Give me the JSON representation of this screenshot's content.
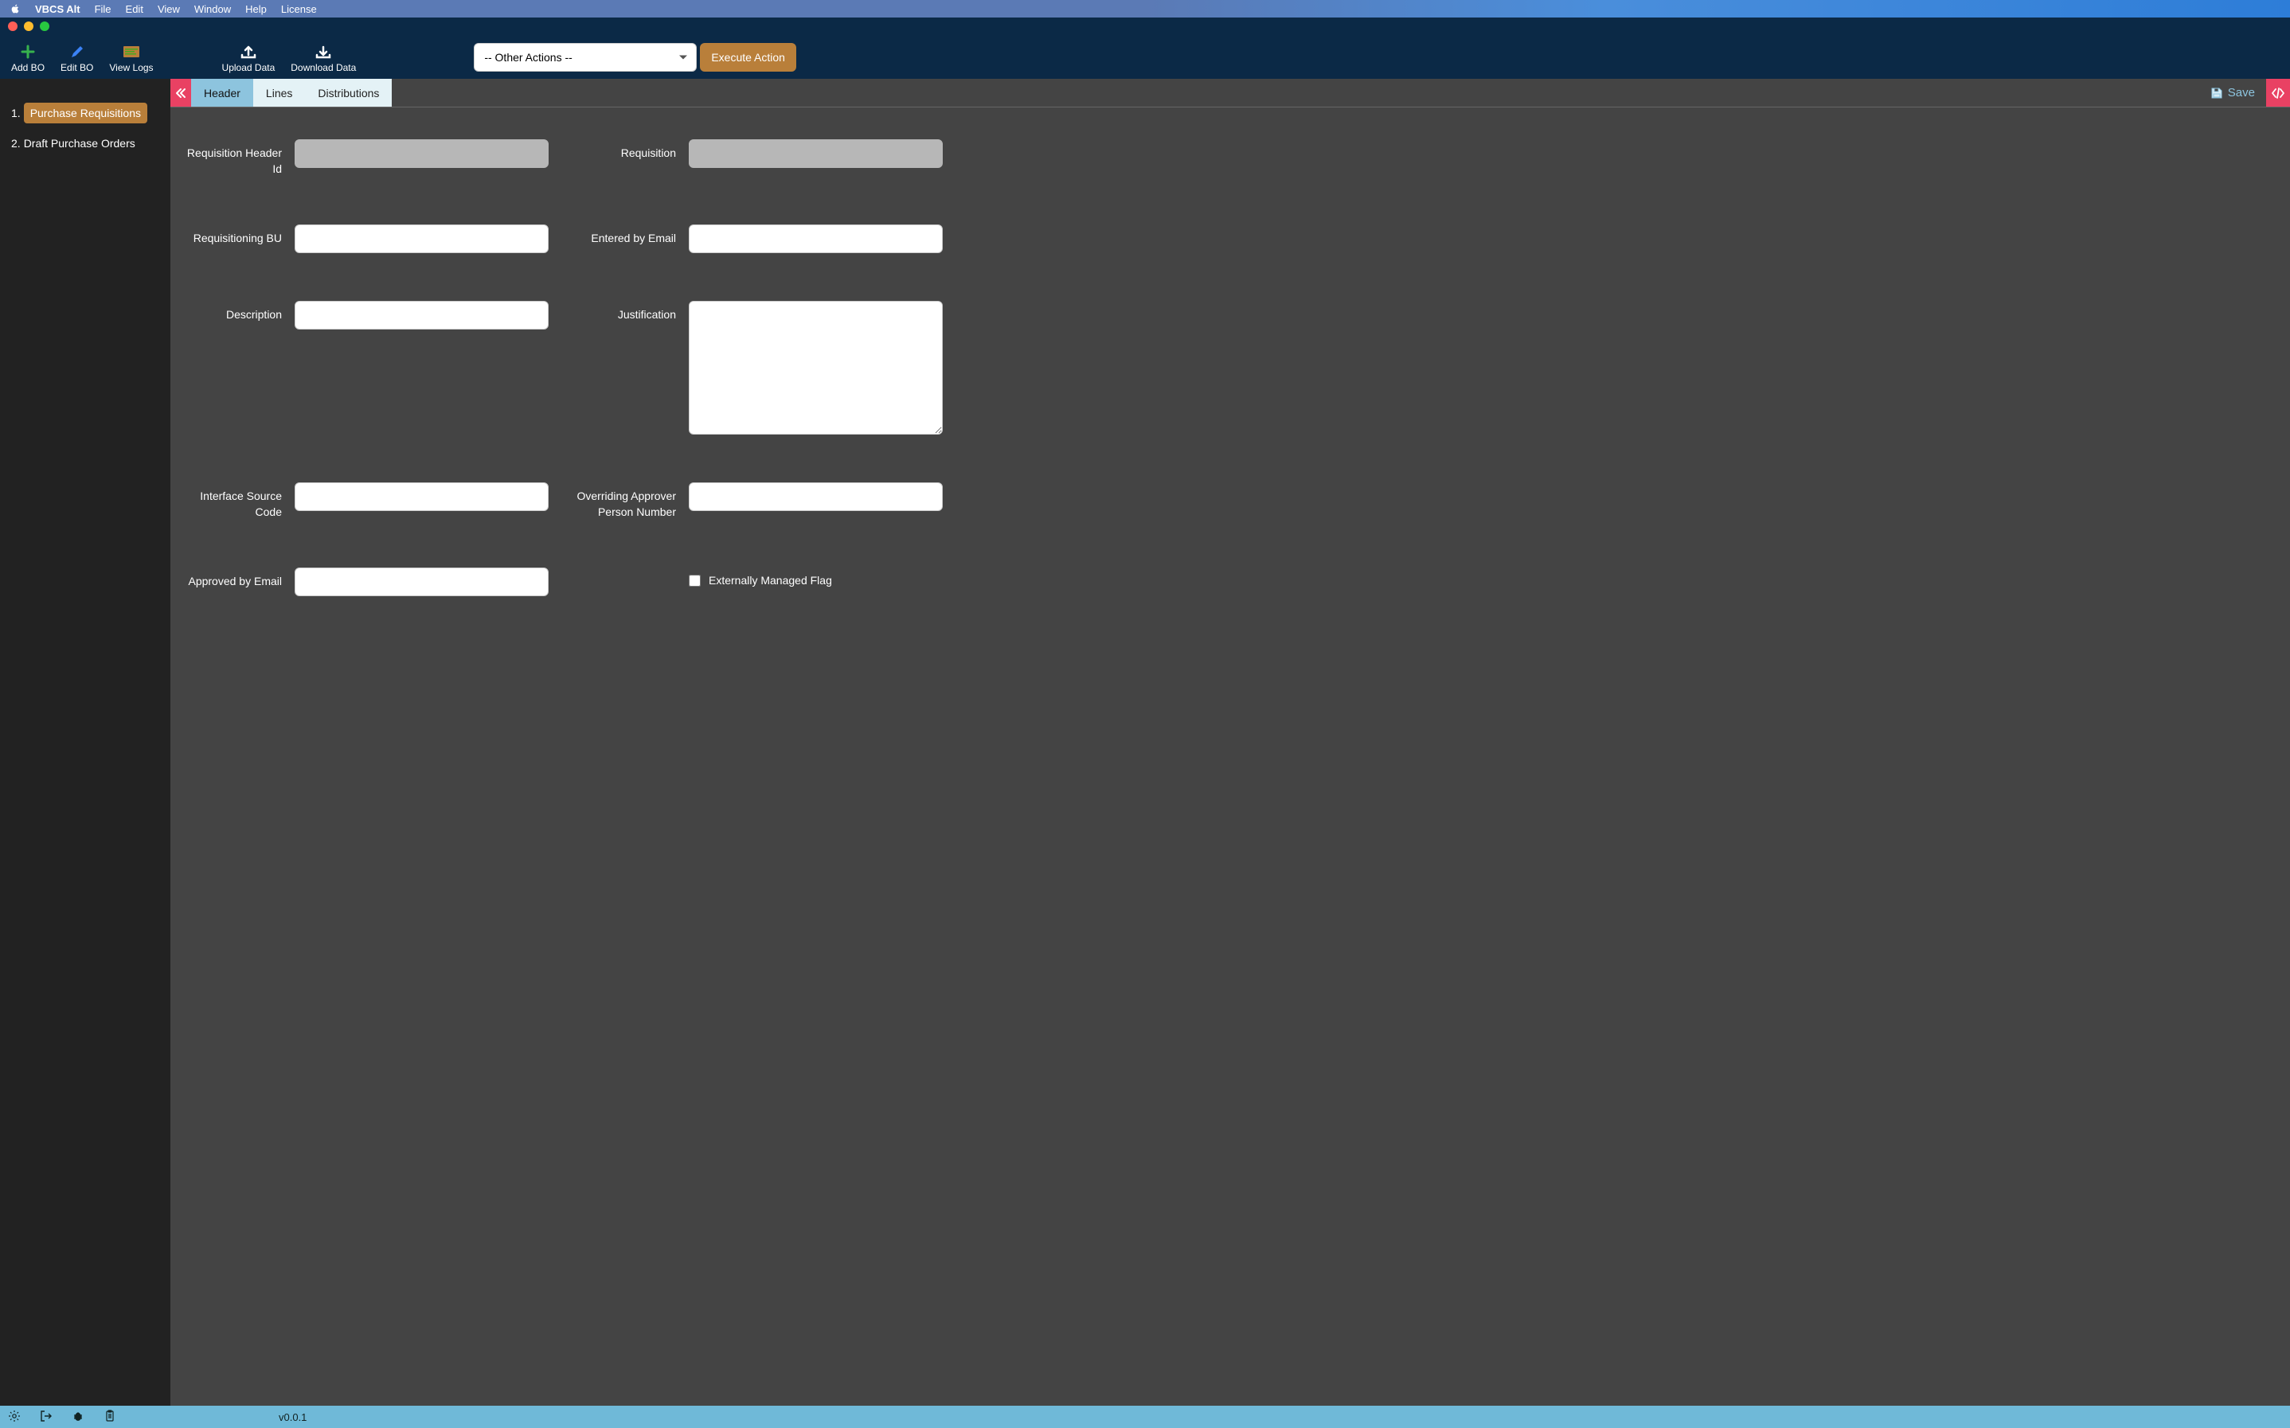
{
  "menubar": {
    "app": "VBCS Alt",
    "items": [
      "File",
      "Edit",
      "View",
      "Window",
      "Help",
      "License"
    ]
  },
  "toolbar": {
    "add_bo": "Add BO",
    "edit_bo": "Edit BO",
    "view_logs": "View Logs",
    "upload_data": "Upload Data",
    "download_data": "Download Data",
    "action_select_value": "-- Other Actions --",
    "execute_action": "Execute Action"
  },
  "sidebar": {
    "items": [
      {
        "label": "Purchase Requisitions",
        "active": true
      },
      {
        "label": "Draft Purchase Orders",
        "active": false
      }
    ]
  },
  "tabs": {
    "items": [
      "Header",
      "Lines",
      "Distributions"
    ],
    "active": 0,
    "save_label": "Save"
  },
  "form": {
    "requisition_header_id": {
      "label": "Requisition Header Id",
      "value": ""
    },
    "requisition": {
      "label": "Requisition",
      "value": ""
    },
    "requisitioning_bu": {
      "label": "Requisitioning BU",
      "value": ""
    },
    "entered_by_email": {
      "label": "Entered by Email",
      "value": ""
    },
    "description": {
      "label": "Description",
      "value": ""
    },
    "justification": {
      "label": "Justification",
      "value": ""
    },
    "interface_source_code": {
      "label": "Interface Source Code",
      "value": ""
    },
    "overriding_approver": {
      "label": "Overriding Approver Person Number",
      "value": ""
    },
    "approved_by_email": {
      "label": "Approved by Email",
      "value": ""
    },
    "externally_managed_flag": {
      "label": "Externally Managed Flag",
      "checked": false
    }
  },
  "statusbar": {
    "version": "v0.0.1"
  },
  "colors": {
    "accent_blue": "#8dc4de",
    "accent_orange": "#b97f3a",
    "accent_pink": "#e94163",
    "panel_dark": "#444444",
    "sidebar_dark": "#222222",
    "header_navy": "#0b2946"
  }
}
